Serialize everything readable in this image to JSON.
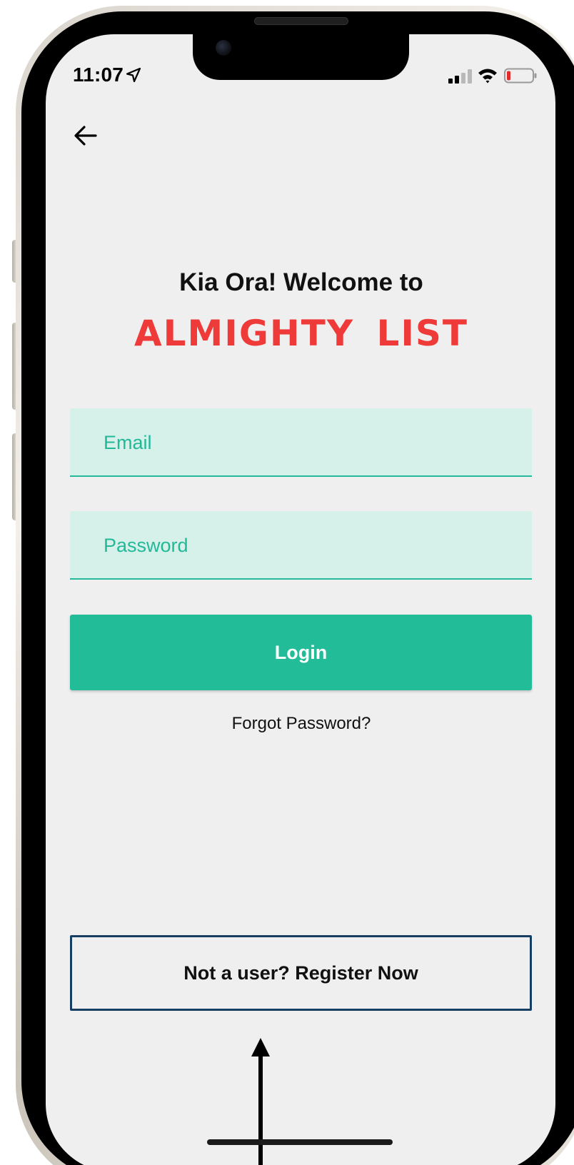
{
  "status_bar": {
    "time": "11:07",
    "icons": [
      "location-arrow-icon",
      "cellular-signal-icon",
      "wifi-icon",
      "battery-low-icon"
    ]
  },
  "header": {
    "back_icon": "arrow-left-icon"
  },
  "welcome": {
    "greeting": "Kia Ora! Welcome to",
    "brand": "ALMIGHTY  LIST"
  },
  "form": {
    "email_placeholder": "Email",
    "password_placeholder": "Password",
    "login_label": "Login",
    "forgot_label": "Forgot Password?"
  },
  "register": {
    "label": "Not a user? Register Now"
  },
  "colors": {
    "accent": "#22bd98",
    "input_bg": "#d6f0ea",
    "brand_red": "#ef3a3a",
    "register_border": "#163e63",
    "screen_bg": "#efefef"
  }
}
